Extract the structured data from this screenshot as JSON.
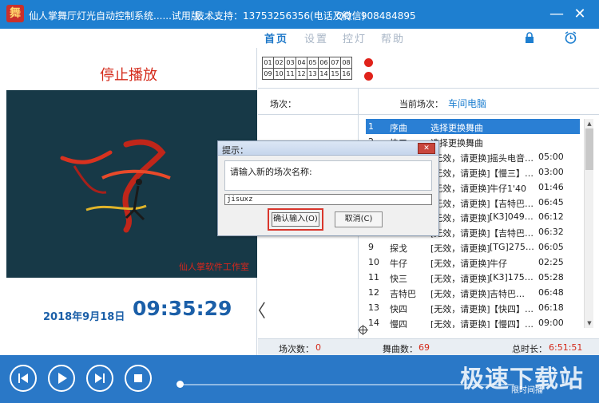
{
  "titlebar": {
    "logo_char": "舞",
    "title": "仙人掌舞厅灯光自动控制系统......试用版......",
    "support": "技术支持：13753256356(电话及微信)",
    "qq": "QQ：908484895",
    "minimize": "—",
    "close": "✕"
  },
  "nav": {
    "items": [
      "首页",
      "设置",
      "控灯",
      "帮助"
    ],
    "active": "首页"
  },
  "left": {
    "status": "停止播放",
    "watermark": "仙人掌软件工作室",
    "date": "2018年9月18日",
    "time": "09:35:29",
    "collapse": "〈"
  },
  "channels": {
    "row1": [
      "01",
      "02",
      "03",
      "04",
      "05",
      "06",
      "07",
      "08"
    ],
    "row2": [
      "09",
      "10",
      "11",
      "12",
      "13",
      "14",
      "15",
      "16"
    ]
  },
  "scene": {
    "label": "场次：",
    "current_label": "当前场次：",
    "current_value": "车间电脑"
  },
  "songs": [
    {
      "num": "1",
      "name": "序曲",
      "status": "选择更换舞曲",
      "track": "",
      "duration": ""
    },
    {
      "num": "2",
      "name": "快三",
      "status": "选择更换舞曲",
      "track": "",
      "duration": ""
    },
    {
      "num": "3",
      "name": "",
      "status": "[无效，请更换]",
      "track": "摇头电音…",
      "duration": "05:00"
    },
    {
      "num": "4",
      "name": "",
      "status": "[无效，请更换]",
      "track": "【慢三】…",
      "duration": "03:00"
    },
    {
      "num": "5",
      "name": "",
      "status": "[无效，请更换]",
      "track": "牛仔1'40",
      "duration": "01:46"
    },
    {
      "num": "6",
      "name": "",
      "status": "[无效，请更换]",
      "track": "【吉特巴…",
      "duration": "06:45"
    },
    {
      "num": "7",
      "name": "",
      "status": "[无效，请更换]",
      "track": "[K3]049…",
      "duration": "06:12"
    },
    {
      "num": "8",
      "name": "",
      "status": "[无效，请更换]",
      "track": "【吉特巴…",
      "duration": "06:32"
    },
    {
      "num": "9",
      "name": "探戈",
      "status": "[无效，请更换]",
      "track": "[TG]275…",
      "duration": "06:05"
    },
    {
      "num": "10",
      "name": "牛仔",
      "status": "[无效，请更换]",
      "track": "牛仔",
      "duration": "02:25"
    },
    {
      "num": "11",
      "name": "快三",
      "status": "[无效，请更换]",
      "track": "[K3]175…",
      "duration": "05:28"
    },
    {
      "num": "12",
      "name": "吉特巴",
      "status": "[无效，请更换]",
      "track": "吉特巴…",
      "duration": "06:48"
    },
    {
      "num": "13",
      "name": "快四",
      "status": "[无效，请更换]",
      "track": "【快四】…",
      "duration": "06:18"
    },
    {
      "num": "14",
      "name": "慢四",
      "status": "[无效，请更换]",
      "track": "【慢四】…",
      "duration": "09:00"
    }
  ],
  "stats": {
    "scene_count_label": "场次数：",
    "scene_count": "0",
    "song_count_label": "舞曲数：",
    "song_count": "69",
    "total_label": "总时长：",
    "total": "6:51:51"
  },
  "dialog": {
    "title": "提示：",
    "close": "✕",
    "prompt": "请输入新的场次名称:",
    "input_value": "jisuxz",
    "confirm": "确认输入(O)",
    "cancel": "取消(C)"
  },
  "bottom": {
    "watermark": "极速下载站",
    "limit_text": "限时间播"
  },
  "colors": {
    "brand_blue": "#1e7fd0",
    "status_red": "#d42a1a",
    "clock_blue": "#1b5fa8",
    "highlight": "#d9362c"
  }
}
